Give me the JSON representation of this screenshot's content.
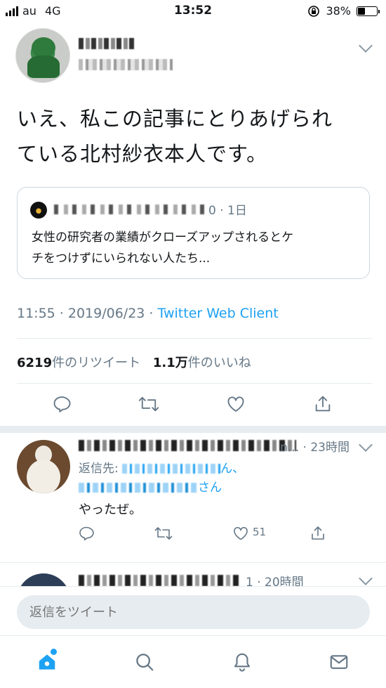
{
  "status_bar": {
    "carrier": "au",
    "network": "4G",
    "time": "13:52",
    "battery": "38%",
    "battery_level": 0.38
  },
  "main_tweet": {
    "text_line1": "いえ、私この記事にとりあげられ",
    "text_line2": "ている北村紗衣本人です。",
    "quoted_tweet": {
      "meta": "0 · 1日",
      "text_line1": "女性の研究者の業績がクローズアップされるとケ",
      "text_line2": "チをつけずにいられない人たち..."
    },
    "timestamp": "11:55 · 2019/06/23 · ",
    "client": "Twitter Web Client",
    "retweet_count": "6219",
    "retweet_label": "件のリツイート",
    "like_count": "1.1万",
    "like_label": "件のいいね"
  },
  "reply": {
    "time": "n... · 23時間",
    "reply_to_label": "返信先: ",
    "reply_to_suffix": "ん、",
    "reply_to_line2_suffix": "さん",
    "text": "やったぜ。",
    "likes": "51"
  },
  "reply2": {
    "time": "1 · 20時間"
  },
  "compose": {
    "placeholder": "返信をツイート"
  },
  "colors": {
    "accent": "#1da1f2",
    "secondary_text": "#657786",
    "border": "#e6ecf0"
  },
  "icons": [
    "reply-icon",
    "retweet-icon",
    "like-icon",
    "share-icon",
    "home-icon",
    "search-icon",
    "notifications-icon",
    "messages-icon",
    "chevron-down-icon"
  ]
}
